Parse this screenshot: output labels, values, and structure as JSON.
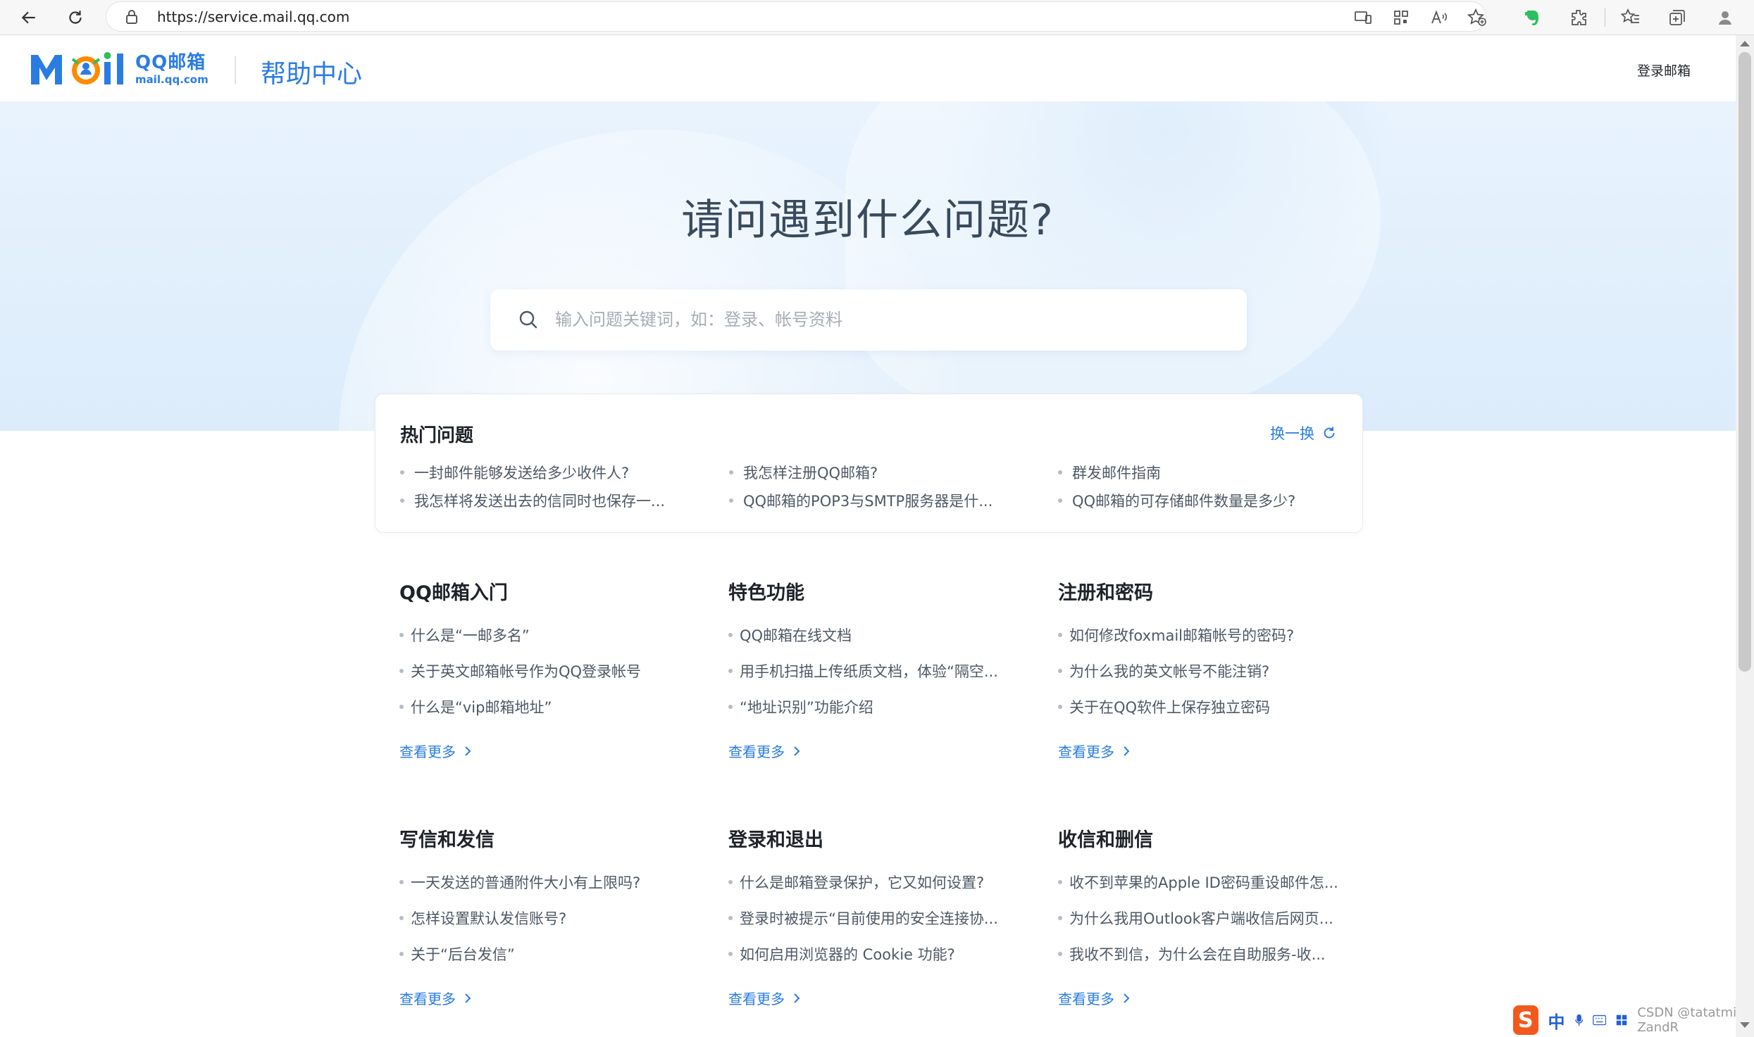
{
  "browser": {
    "url": "https://service.mail.qq.com"
  },
  "header": {
    "logo_mail": "Mail",
    "logo_qq_line1": "QQ邮箱",
    "logo_qq_line2": "mail.qq.com",
    "help_title": "帮助中心",
    "login_label": "登录邮箱"
  },
  "hero": {
    "title": "请问遇到什么问题?",
    "search_placeholder": "输入问题关键词，如：登录、帐号资料"
  },
  "hot": {
    "title": "热门问题",
    "refresh_label": "换一换",
    "items": [
      "一封邮件能够发送给多少收件人?",
      "我怎样注册QQ邮箱?",
      "群发邮件指南",
      "我怎样将发送出去的信同时也保存一...",
      "QQ邮箱的POP3与SMTP服务器是什...",
      "QQ邮箱的可存储邮件数量是多少?"
    ]
  },
  "categories": [
    {
      "title": "QQ邮箱入门",
      "items": [
        "什么是“一邮多名”",
        "关于英文邮箱帐号作为QQ登录帐号",
        "什么是“vip邮箱地址”"
      ],
      "more": "查看更多"
    },
    {
      "title": "特色功能",
      "items": [
        "QQ邮箱在线文档",
        "用手机扫描上传纸质文档，体验“隔空...",
        "“地址识别”功能介绍"
      ],
      "more": "查看更多"
    },
    {
      "title": "注册和密码",
      "items": [
        "如何修改foxmail邮箱帐号的密码?",
        "为什么我的英文帐号不能注销?",
        "关于在QQ软件上保存独立密码"
      ],
      "more": "查看更多"
    },
    {
      "title": "写信和发信",
      "items": [
        "一天发送的普通附件大小有上限吗?",
        "怎样设置默认发信账号?",
        "关于“后台发信”"
      ],
      "more": "查看更多"
    },
    {
      "title": "登录和退出",
      "items": [
        "什么是邮箱登录保护，它又如何设置?",
        "登录时被提示“目前使用的安全连接协...",
        "如何启用浏览器的 Cookie 功能?"
      ],
      "more": "查看更多"
    },
    {
      "title": "收信和删信",
      "items": [
        "收不到苹果的Apple ID密码重设邮件怎...",
        "为什么我用Outlook客户端收信后网页...",
        "我收不到信，为什么会在自助服务-收..."
      ],
      "more": "查看更多"
    }
  ],
  "ime": {
    "lang": "中",
    "watermark": "CSDN @tatatmi  ZandR"
  },
  "colors": {
    "brand_blue": "#2a7ce3",
    "hero_bg": "#e4f0fc",
    "title_gray": "#394a5e"
  }
}
